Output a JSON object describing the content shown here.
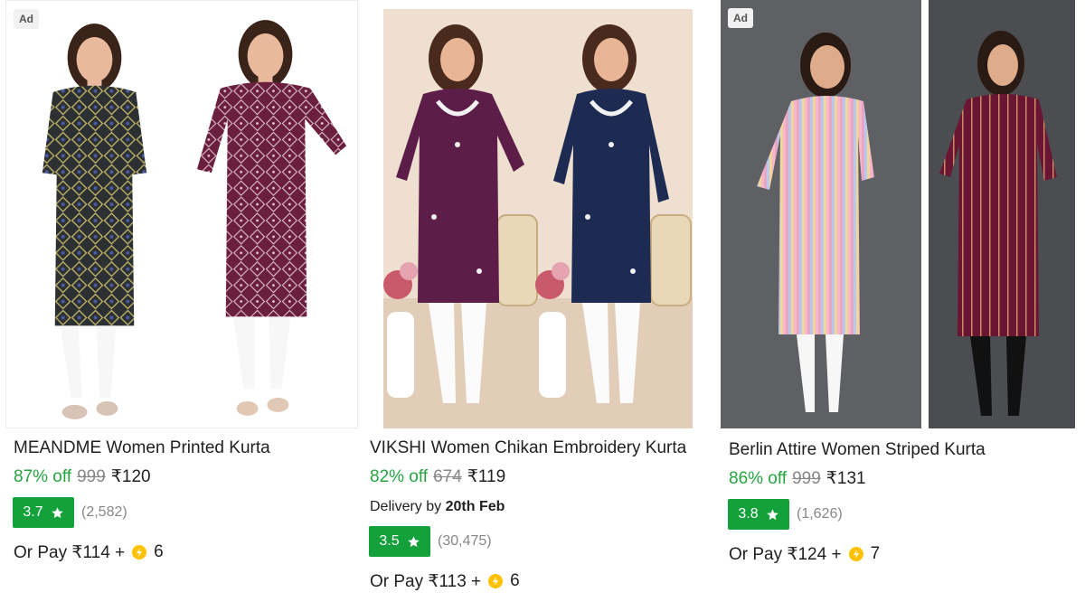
{
  "products": [
    {
      "ad_label": "Ad",
      "title": "MEANDME Women Printed Kurta",
      "discount": "87% off",
      "mrp": "999",
      "price": "₹120",
      "rating": "3.7",
      "rating_count": "(2,582)",
      "pay_prefix": "Or Pay ₹114 +",
      "coin_count": "6",
      "colors": {
        "primary": "#2d3033",
        "secondary": "#6b1f3e",
        "pattern": "#c2b86a"
      }
    },
    {
      "title": "VIKSHI Women Chikan Embroidery Kurta",
      "discount": "82% off",
      "mrp": "674",
      "price": "₹119",
      "delivery_prefix": "Delivery by",
      "delivery_date": "20th Feb",
      "rating": "3.5",
      "rating_count": "(30,475)",
      "pay_prefix": "Or Pay ₹113 +",
      "coin_count": "6",
      "colors": {
        "primary": "#5c1e48",
        "secondary": "#1d2a52",
        "background": "#eedfd0"
      }
    },
    {
      "ad_label": "Ad",
      "title": "Berlin Attire Women Striped Kurta",
      "discount": "86% off",
      "mrp": "999",
      "price": "₹131",
      "rating": "3.8",
      "rating_count": "(1,626)",
      "pay_prefix": "Or Pay ₹124 +",
      "coin_count": "7",
      "colors": {
        "primary": "#e7a6c6",
        "secondary": "#6a1632",
        "background": "#5e6063"
      }
    }
  ],
  "theme": {
    "discount_green": "#26a541",
    "rating_green": "#14a03a",
    "coin_gold": "#ffc200"
  }
}
